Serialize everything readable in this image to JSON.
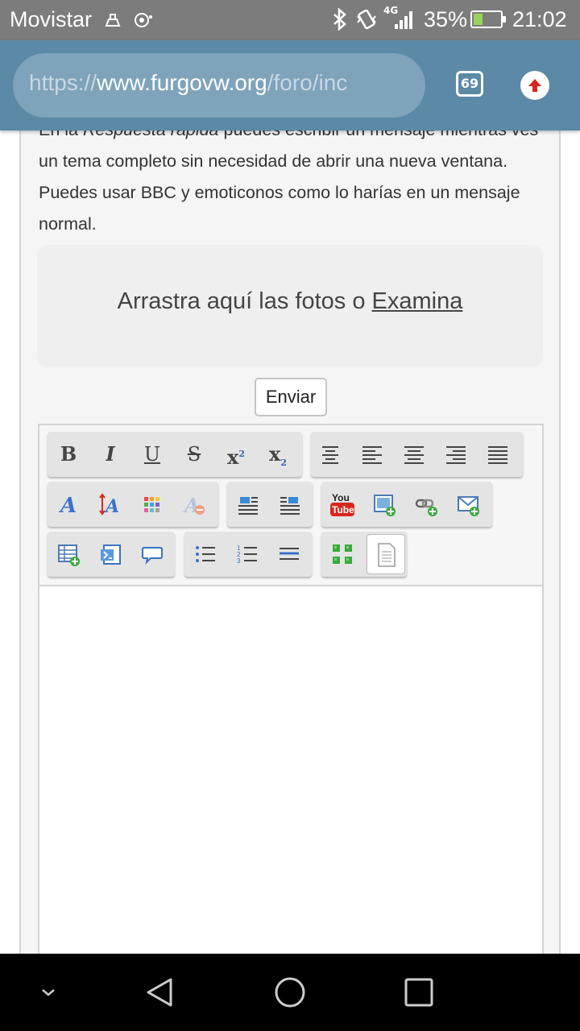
{
  "status_bar": {
    "carrier": "Movistar",
    "network": "4G",
    "battery_percent": "35%",
    "battery_level": 0.35,
    "time": "21:02",
    "icons": [
      "notification-icon",
      "cast-icon",
      "bluetooth-icon",
      "vibrate-icon",
      "signal-icon",
      "battery-icon"
    ]
  },
  "browser": {
    "url_scheme": "https://",
    "url_host": "www.furgovw.org",
    "url_path": "/foro/inc",
    "tab_count": "69"
  },
  "page": {
    "intro_prefix": "En la ",
    "intro_italic": "Respuesta rápida",
    "intro_suffix": " puedes escribir un mensaje mientras ves un tema completo sin necesidad de abrir una nueva ventana. Puedes usar BBC y emoticonos como lo harías en un mensaje normal.",
    "dropzone_text": "Arrastra aquí las fotos o ",
    "dropzone_link": "Examina",
    "send_label": "Enviar"
  },
  "editor": {
    "toolbar": {
      "bold": "B",
      "italic": "I",
      "underline": "U",
      "strike": "S",
      "superscript": "x",
      "subscript": "x",
      "youtube_you": "You",
      "youtube_tube": "Tube"
    }
  },
  "colors": {
    "url_bar": "#5b89a6",
    "status_bar": "#7c7c7c",
    "accent_red": "#d9261c"
  }
}
